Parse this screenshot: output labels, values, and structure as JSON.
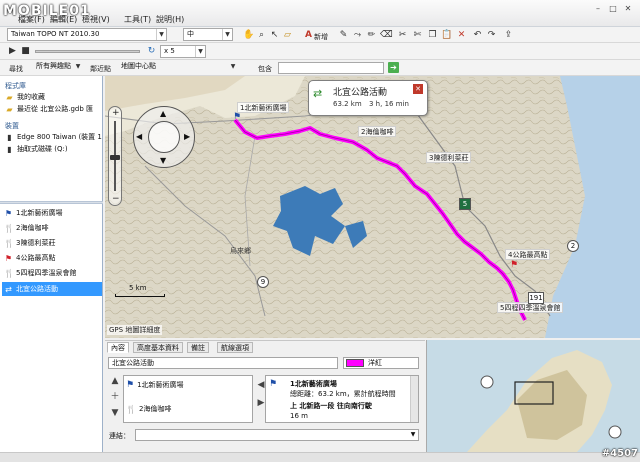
{
  "app": {
    "logo": "MOBILE01",
    "menu": [
      "檔案(F)",
      "編輯(E)",
      "檢視(V)",
      "工具(T)",
      "說明(H)"
    ],
    "window_buttons": [
      "–",
      "□",
      "✕"
    ]
  },
  "toolbar": {
    "map_product": "Taiwan TOPO NT 2010.30",
    "zoom_detail": "中",
    "new_label": "新增",
    "speed": "x 5"
  },
  "toolbar2": {
    "search_label": "尋找",
    "category": "所有興趣點",
    "near_label": "鄰近點",
    "near_target": "地圖中心點",
    "contains_label": "包含"
  },
  "left": {
    "library_header": "程式庫",
    "library_items": [
      "我的收藏",
      "最近從 北宜公路.gdb 匯"
    ],
    "devices_header": "裝置",
    "device_items": [
      "Edge 800 Taiwan (裝置 1",
      "抽取式磁碟 (Q:)"
    ],
    "waypoints": [
      {
        "icon": "flag",
        "label": "1北新藝術廣場"
      },
      {
        "icon": "fork",
        "label": "2海倫咖啡"
      },
      {
        "icon": "fork",
        "label": "3陳德利菜莊"
      },
      {
        "icon": "redflag",
        "label": "4公路最高點"
      },
      {
        "icon": "fork",
        "label": "5四程四季溫泉會館"
      },
      {
        "icon": "route",
        "label": "北宜公路活動"
      }
    ]
  },
  "map": {
    "callout_title": "北宜公路活動",
    "callout_distance": "63.2 km",
    "callout_time": "3 h, 16 min",
    "labels": [
      "1北新藝術廣場",
      "2海倫咖啡",
      "3陳德利菜莊",
      "4公路最高點",
      "5四程四季溫泉會館",
      "烏來鄉"
    ],
    "road_numbers": [
      "9",
      "2",
      "5",
      "191"
    ],
    "scale": "5 km",
    "source": "GPS 地圖詳細度"
  },
  "bottom": {
    "tabs": [
      "內容",
      "高度基本資料",
      "備註",
      "航線選項"
    ],
    "route_name": "北宜公路活動",
    "color_name": "洋紅",
    "route_points": [
      "1北新藝術廣場",
      "2海倫咖啡"
    ],
    "details_title": "1北新藝術廣場",
    "details_summary": "總距離：63.2 km，累計航程時間",
    "details_direction": "上 北新路一段 往向南行駛",
    "details_distance": "16 m",
    "link_label": "連結："
  },
  "watermark": "#4507"
}
